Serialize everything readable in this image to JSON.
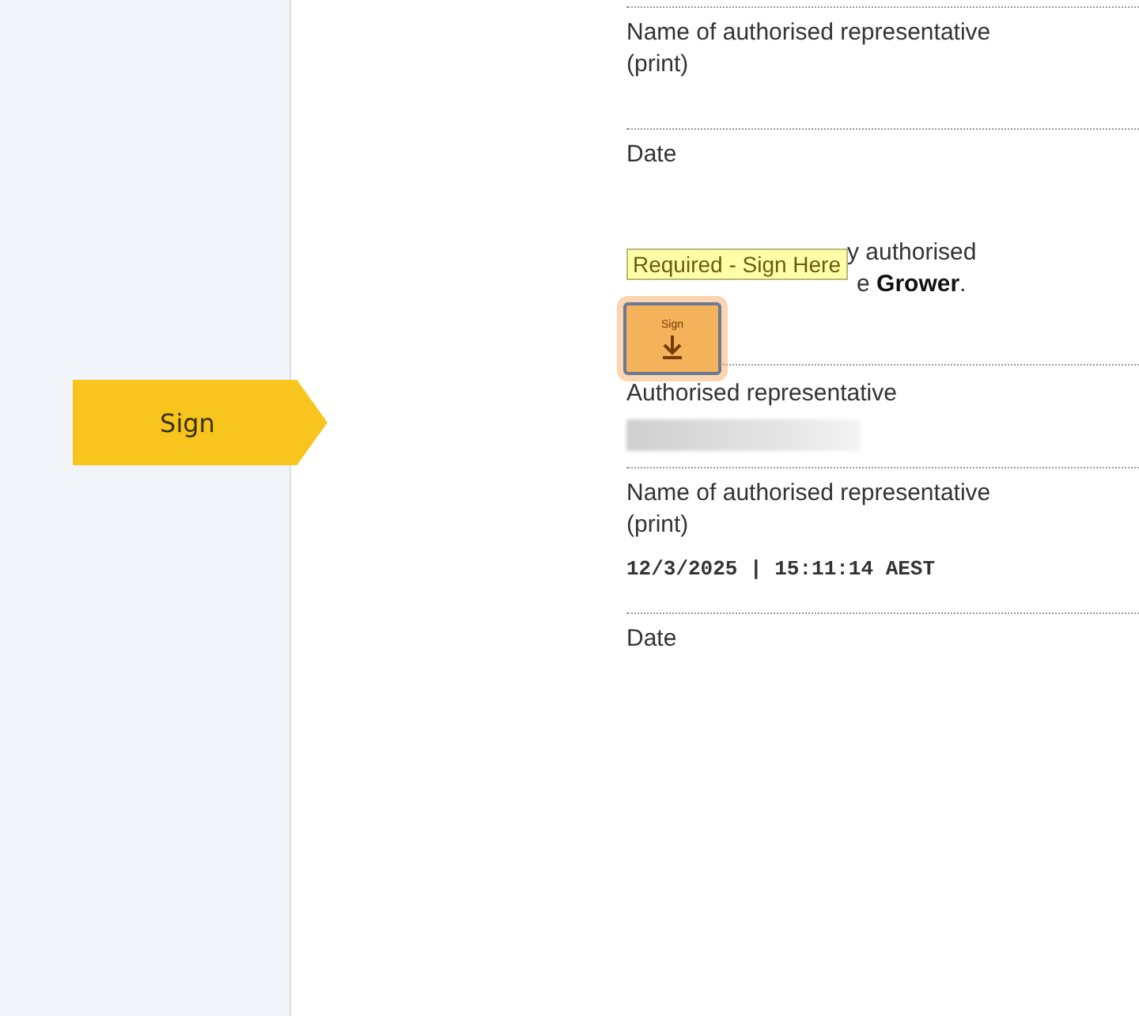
{
  "sidebar": {
    "sign_tab": {
      "label": "Sign"
    }
  },
  "document": {
    "blocks": [
      {
        "kind": "field",
        "label": "Name of authorised representative (print)"
      },
      {
        "kind": "field",
        "label": "Date"
      },
      {
        "kind": "statement",
        "lines": [
          "y authorised",
          "e **Grower**."
        ]
      },
      {
        "kind": "signature",
        "label": "Authorised representative",
        "stamp_label": "Sign",
        "tooltip": "Required - Sign Here",
        "redacted": true
      },
      {
        "kind": "field",
        "label": "Name of authorised representative (print)",
        "value": "12/3/2025 | 15:11:14 AEST"
      },
      {
        "kind": "field",
        "label": "Date"
      }
    ]
  }
}
